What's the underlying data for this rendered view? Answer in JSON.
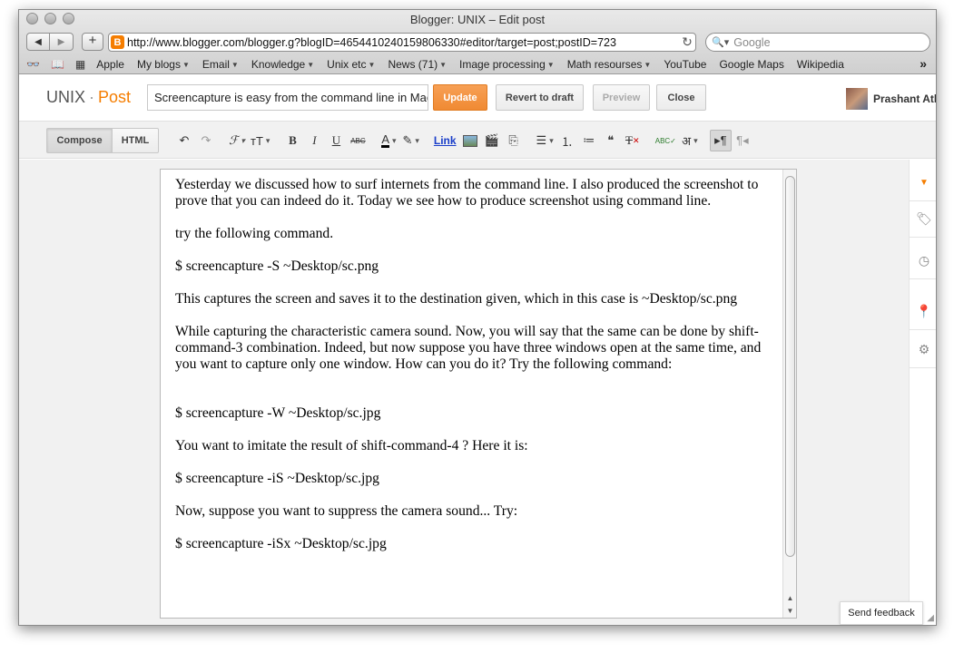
{
  "window": {
    "title": "Blogger: UNIX – Edit post"
  },
  "browser": {
    "url": "http://www.blogger.com/blogger.g?blogID=4654410240159806330#editor/target=post;postID=723",
    "search_placeholder": "Google",
    "bookmarks": [
      {
        "label": "Apple",
        "dropdown": false
      },
      {
        "label": "My blogs",
        "dropdown": true
      },
      {
        "label": "Email",
        "dropdown": true
      },
      {
        "label": "Knowledge",
        "dropdown": true
      },
      {
        "label": "Unix etc",
        "dropdown": true
      },
      {
        "label": "News (71)",
        "dropdown": true
      },
      {
        "label": "Image processing",
        "dropdown": true
      },
      {
        "label": "Math resourses",
        "dropdown": true
      },
      {
        "label": "YouTube",
        "dropdown": false
      },
      {
        "label": "Google Maps",
        "dropdown": false
      },
      {
        "label": "Wikipedia",
        "dropdown": false
      }
    ]
  },
  "header": {
    "blog_name": "UNIX",
    "section": "Post",
    "post_title": "Screencapture is easy from the command line in Mac",
    "update_label": "Update",
    "revert_label": "Revert to draft",
    "preview_label": "Preview",
    "close_label": "Close",
    "user_name": "Prashant Athavale"
  },
  "toolbar": {
    "compose_label": "Compose",
    "html_label": "HTML",
    "link_label": "Link",
    "bold": "B",
    "italic": "I",
    "underline": "U",
    "strike": "ABC",
    "hindi": "अ"
  },
  "content": {
    "paragraphs": [
      "Yesterday we discussed how to surf internets from the command line. I also produced the screenshot to prove that you can indeed do it. Today we see how to produce screenshot using command line.",
      "try the following command.",
      "$ screencapture -S ~Desktop/sc.png",
      "This captures the screen and saves it to the destination given, which in this case is ~Desktop/sc.png",
      "While capturing the characteristic camera sound. Now, you will say that the same can be done by shift-command-3 combination. Indeed, but now suppose you have three windows open at the same time, and you want to capture only one window. How can you do it? Try the following command:",
      "$ screencapture -W ~Desktop/sc.jpg",
      "You want to imitate the result of shift-command-4 ? Here it is:",
      "$ screencapture -iS ~Desktop/sc.jpg",
      "Now, suppose you want to suppress the camera sound... Try:",
      "$ screencapture -iSx ~Desktop/sc.jpg"
    ]
  },
  "sidebar": {
    "icons": [
      "post-settings-arrow-icon",
      "labels-tag-icon",
      "schedule-clock-icon",
      "location-pin-icon",
      "options-gear-icon"
    ]
  },
  "feedback_label": "Send feedback",
  "colors": {
    "accent": "#f57d00",
    "update_button": "#f08a33",
    "link": "#1a3ec9"
  }
}
